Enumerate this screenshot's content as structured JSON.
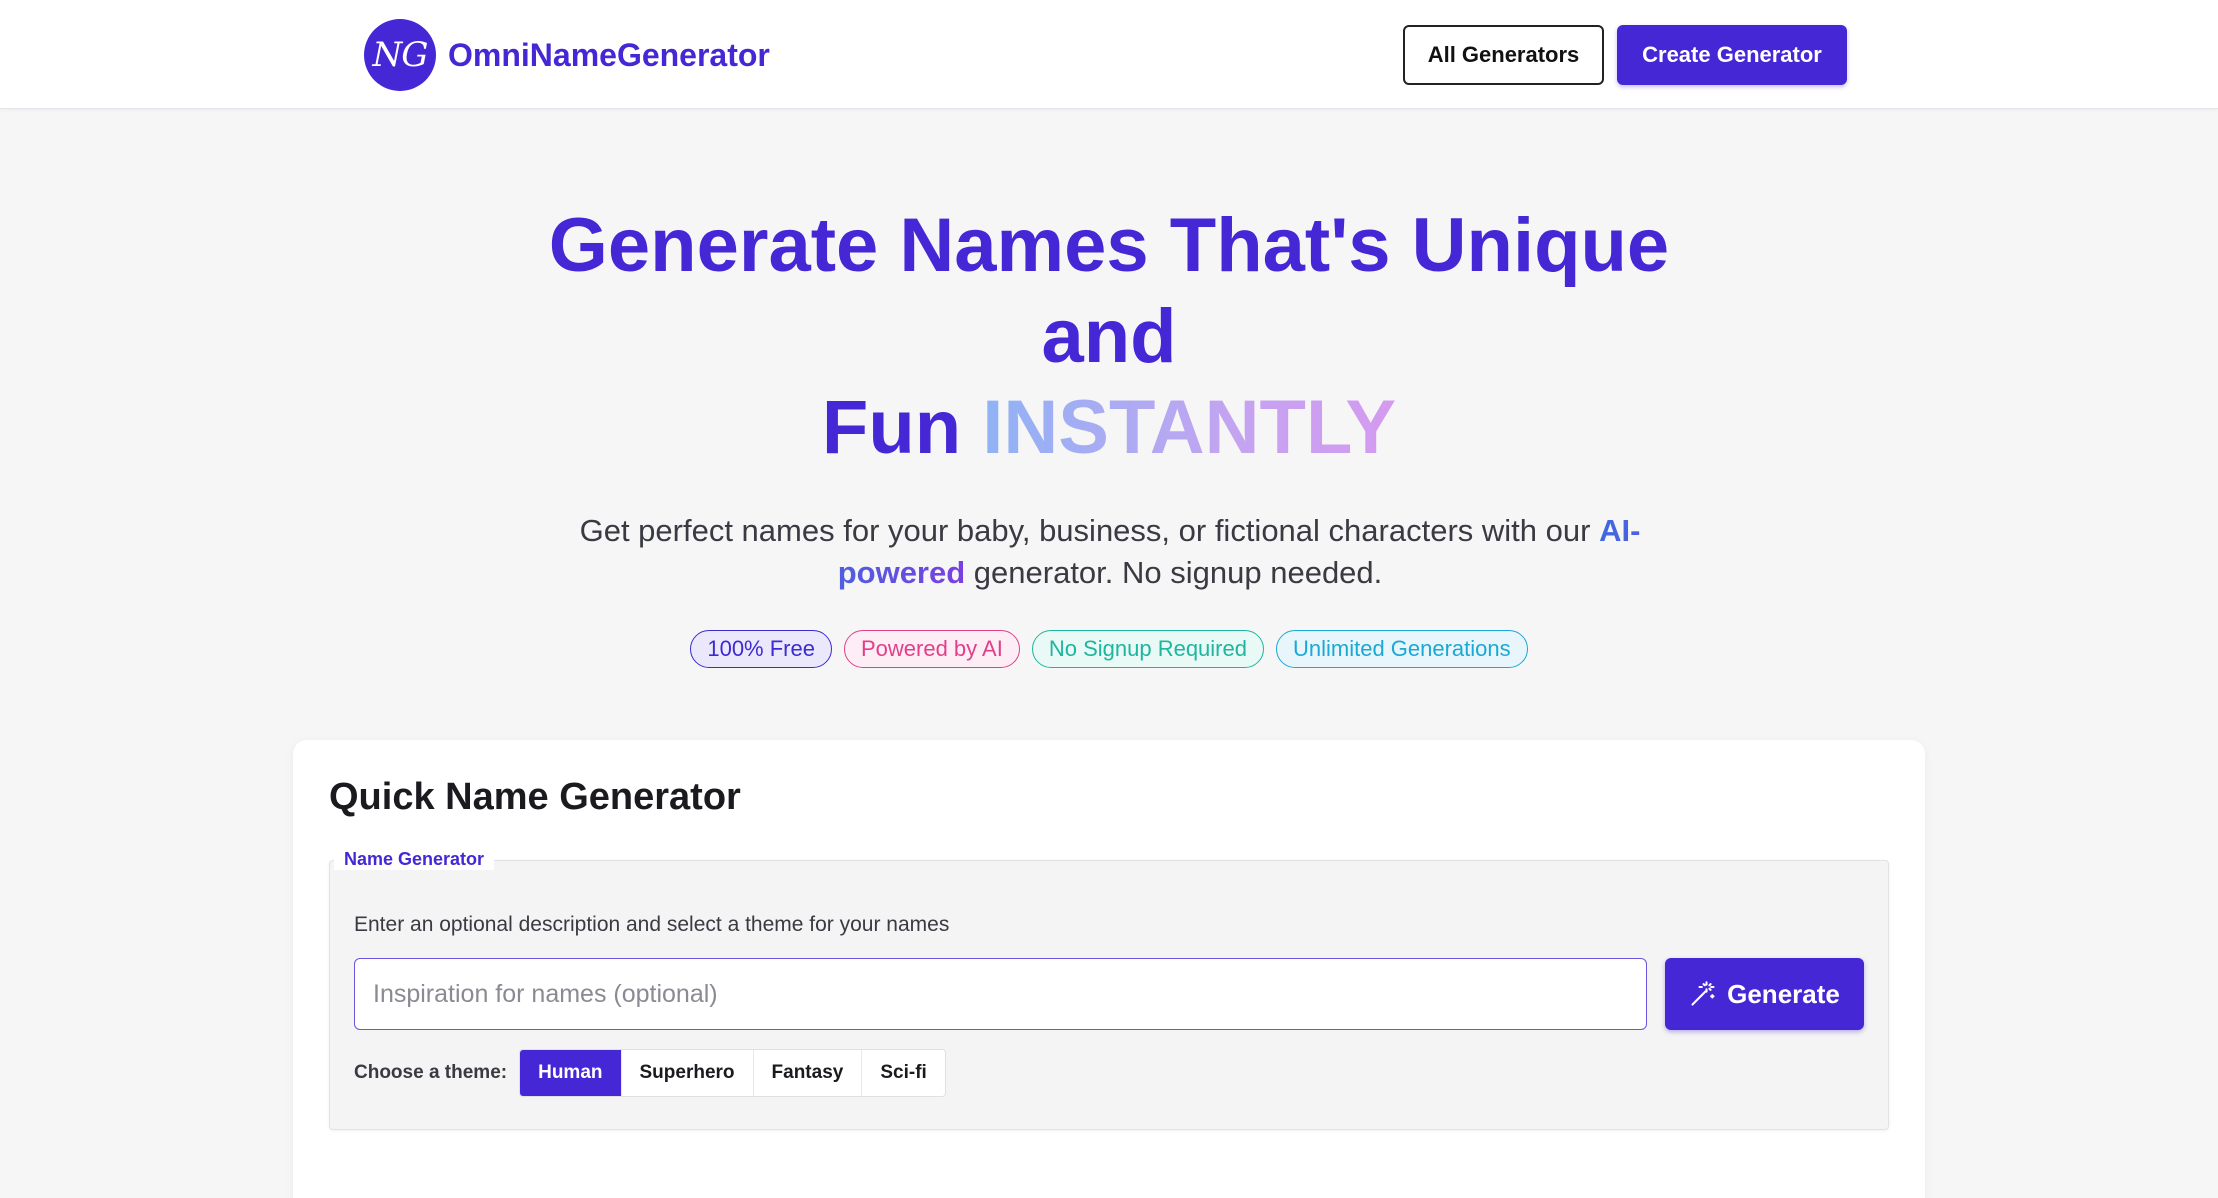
{
  "header": {
    "logo_mark": "NG",
    "brand": "OmniNameGenerator",
    "all_generators": "All Generators",
    "create_generator": "Create Generator"
  },
  "hero": {
    "title_line1": "Generate Names That's Unique",
    "title_line2": "and",
    "title_line3_prefix": "Fun",
    "title_line3_highlight": "INSTANTLY",
    "subtitle_part1": "Get perfect names for your baby, business, or fictional characters with our",
    "subtitle_highlight": "AI-powered",
    "subtitle_part2": "generator. No signup needed.",
    "badges": [
      "100% Free",
      "Powered by AI",
      "No Signup Required",
      "Unlimited Generations"
    ]
  },
  "generator": {
    "card_title": "Quick Name Generator",
    "legend": "Name Generator",
    "instructions": "Enter an optional description and select a theme for your names",
    "input_placeholder": "Inspiration for names (optional)",
    "input_value": "",
    "generate_label": "Generate",
    "generate_icon": "magic-wand-icon",
    "theme_label": "Choose a theme:",
    "themes": [
      "Human",
      "Superhero",
      "Fantasy",
      "Sci-fi"
    ],
    "selected_theme": "Human"
  },
  "colors": {
    "brand": "#4527d6",
    "badge_free": "#3b2bd0",
    "badge_ai": "#e0408a",
    "badge_signup": "#1fb5a0",
    "badge_unlimited": "#1ba8d4"
  }
}
